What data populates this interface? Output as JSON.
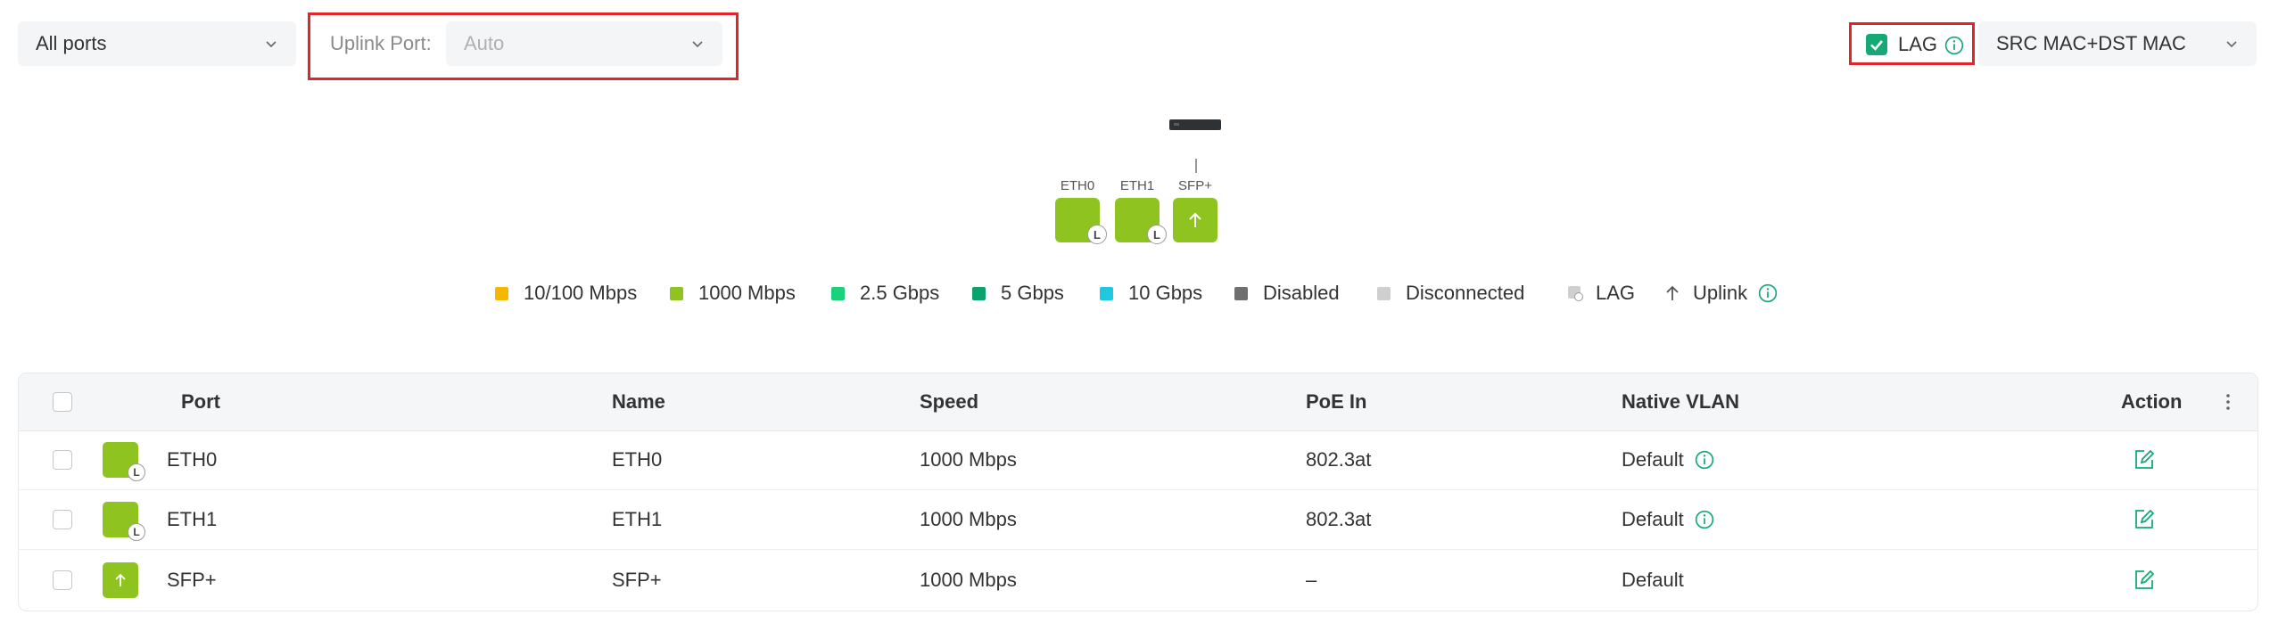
{
  "filters": {
    "all_ports": "All ports",
    "uplink_label": "Uplink Port:",
    "uplink_value": "Auto",
    "lag_label": "LAG",
    "lag_checked": true,
    "hash_value": "SRC MAC+DST MAC"
  },
  "diagram": {
    "ports": [
      {
        "label": "ETH0",
        "badge": "L"
      },
      {
        "label": "ETH1",
        "badge": "L"
      },
      {
        "label": "SFP+",
        "badge": ""
      }
    ]
  },
  "legend": [
    {
      "label": "10/100 Mbps",
      "color": "#f5b800"
    },
    {
      "label": "1000 Mbps",
      "color": "#8fc31f"
    },
    {
      "label": "2.5 Gbps",
      "color": "#19d27a"
    },
    {
      "label": "5 Gbps",
      "color": "#0aa36b"
    },
    {
      "label": "10 Gbps",
      "color": "#1ec8e0"
    },
    {
      "label": "Disabled",
      "color": "#6f6f6f"
    },
    {
      "label": "Disconnected",
      "color": "#cfcfcf"
    },
    {
      "label": "LAG",
      "color": "#cfcfcf"
    },
    {
      "label": "Uplink",
      "color": ""
    }
  ],
  "table": {
    "headers": {
      "port": "Port",
      "name": "Name",
      "speed": "Speed",
      "poe": "PoE In",
      "vlan": "Native VLAN",
      "action": "Action"
    },
    "rows": [
      {
        "port": "ETH0",
        "name": "ETH0",
        "speed": "1000 Mbps",
        "poe": "802.3at",
        "vlan": "Default",
        "badge": "L"
      },
      {
        "port": "ETH1",
        "name": "ETH1",
        "speed": "1000 Mbps",
        "poe": "802.3at",
        "vlan": "Default",
        "badge": "L"
      },
      {
        "port": "SFP+",
        "name": "SFP+",
        "speed": "1000 Mbps",
        "poe": "–",
        "vlan": "Default",
        "badge": ""
      }
    ]
  },
  "colors": {
    "accent": "#16a974",
    "port_green": "#8fc31f",
    "highlight_red": "#e0262b"
  }
}
